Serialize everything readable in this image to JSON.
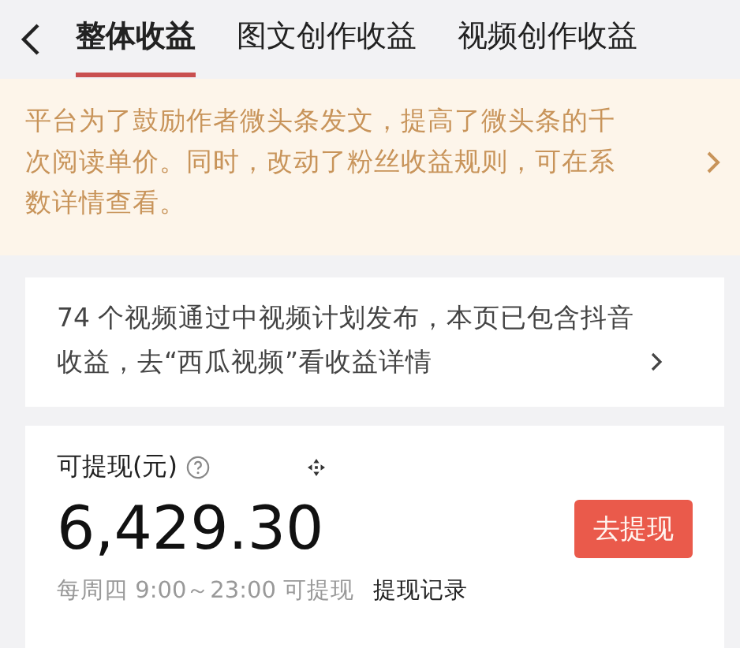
{
  "tabs": [
    {
      "label": "整体收益",
      "selected": true
    },
    {
      "label": "图文创作收益",
      "selected": false
    },
    {
      "label": "视频创作收益",
      "selected": false
    }
  ],
  "notice": {
    "text": "平台为了鼓励作者微头条发文，提高了微头条的千次阅读单价。同时，改动了粉丝收益规则，可在系数详情查看。"
  },
  "video_card": {
    "text": "74 个视频通过中视频计划发布，本页已包含抖音收益，去“西瓜视频”看收益详情"
  },
  "withdraw": {
    "label": "可提现(元)",
    "amount": "6,429.30",
    "button": "去提现",
    "schedule": "每周四 9:00～23:00 可提现",
    "records_link": "提现记录"
  }
}
